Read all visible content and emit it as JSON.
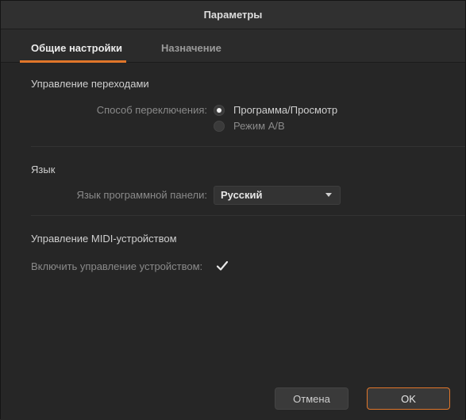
{
  "window": {
    "title": "Параметры"
  },
  "tabs": [
    {
      "label": "Общие настройки",
      "active": true
    },
    {
      "label": "Назначение",
      "active": false
    }
  ],
  "sections": {
    "transitions": {
      "title": "Управление переходами",
      "switch_label": "Способ переключения:",
      "options": [
        {
          "label": "Программа/Просмотр",
          "selected": true
        },
        {
          "label": "Режим A/B",
          "selected": false
        }
      ]
    },
    "language": {
      "title": "Язык",
      "panel_language_label": "Язык программной панели:",
      "selected_language": "Русский"
    },
    "midi": {
      "title": "Управление MIDI-устройством",
      "enable_label": "Включить управление устройством:",
      "enabled": true
    }
  },
  "buttons": {
    "cancel": "Отмена",
    "ok": "OK"
  },
  "colors": {
    "accent": "#e0762a",
    "background": "#262626",
    "titlebar": "#303030"
  }
}
